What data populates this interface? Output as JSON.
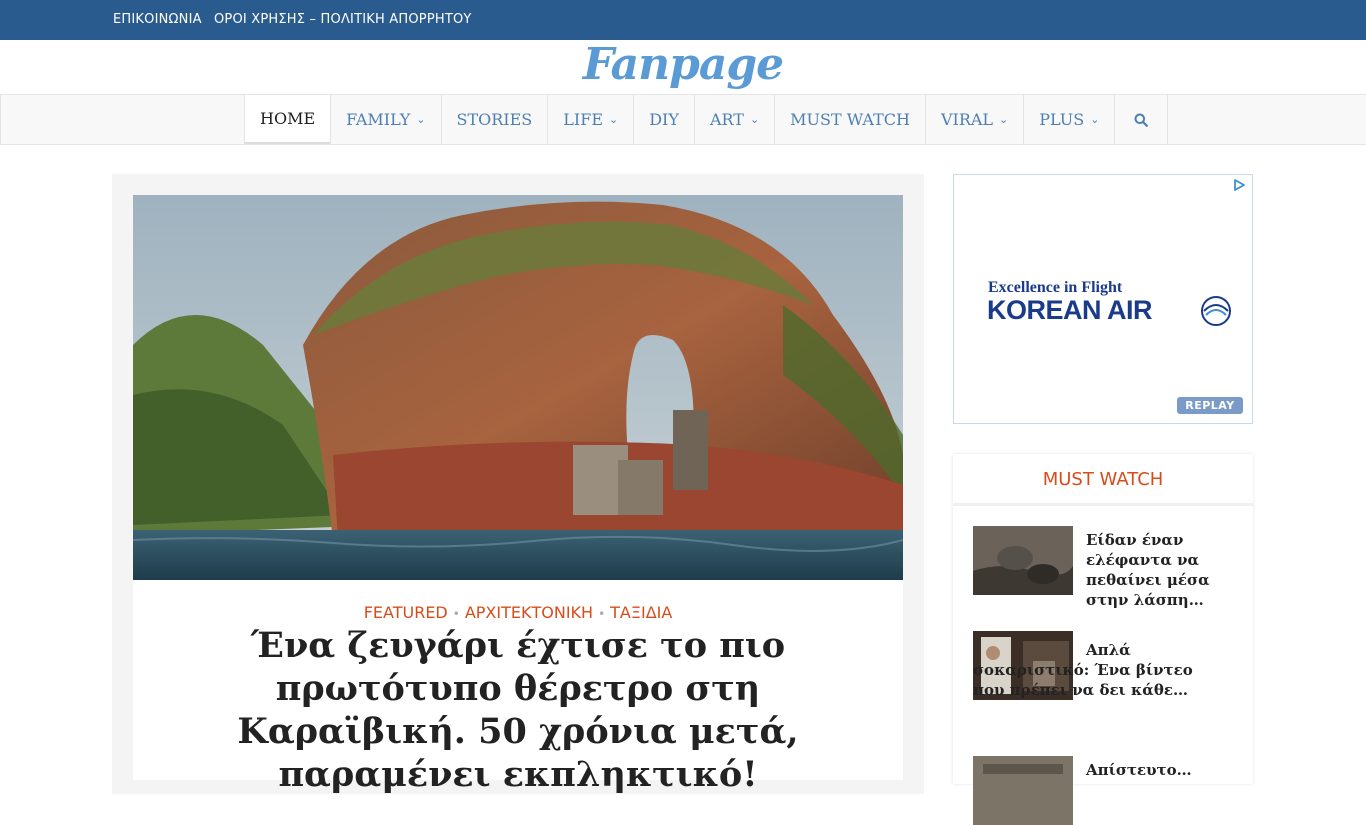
{
  "topbar": {
    "links": [
      "ΕΠΙΚΟΙΝΩΝΙΑ",
      "ΟΡΟΙ ΧΡΗΣΗΣ – ΠΟΛΙΤΙΚΗ ΑΠΟΡΡΗΤΟΥ"
    ]
  },
  "logo": {
    "text": "Fanpage"
  },
  "nav": {
    "items": [
      {
        "label": "HOME",
        "active": true
      },
      {
        "label": "FAMILY",
        "dropdown": true
      },
      {
        "label": "STORIES"
      },
      {
        "label": "LIFE",
        "dropdown": true
      },
      {
        "label": "DIY"
      },
      {
        "label": "ART",
        "dropdown": true
      },
      {
        "label": "MUST WATCH"
      },
      {
        "label": "VIRAL",
        "dropdown": true
      },
      {
        "label": "PLUS",
        "dropdown": true
      }
    ],
    "search_icon": "search-icon"
  },
  "article": {
    "categories": [
      "FEATURED",
      "ΑΡΧΙΤΕΚΤΟΝΙΚΗ",
      "ΤΑΞΙΔΙΑ"
    ],
    "headline": "Ένα ζευγάρι έχτισε το πιο πρωτότυπο θέρετρο στη Καραϊβική. 50 χρόνια μετά, παραμένει εκπληκτικό!"
  },
  "ad": {
    "slogan": "Excellence in Flight",
    "brand": "KOREAN AIR",
    "replay": "REPLAY"
  },
  "widget": {
    "title": "MUST WATCH",
    "posts": [
      {
        "title": "Είδαν έναν ελέφαντα να πεθαίνει μέσα στην λάσπη…"
      },
      {
        "title": "Απλά σοκαριστικό: Ένα βίντεο που πρέπει να δει κάθε…"
      },
      {
        "title": "Απίστευτο…"
      }
    ]
  },
  "colors": {
    "topbar": "#2a5b8f",
    "accent": "#d94c1a",
    "nav_link": "#4d7fb3",
    "logo": "#5a9bd6"
  }
}
